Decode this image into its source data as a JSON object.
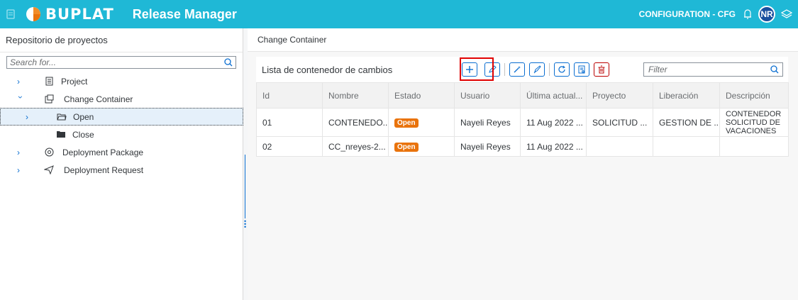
{
  "header": {
    "logo_text": "BUPLAT",
    "app_title": "Release Manager",
    "config_label": "CONFIGURATION - CFG",
    "avatar_initials": "NR",
    "icons": [
      "menu-icon",
      "logo-icon",
      "notifications-icon",
      "layers-icon"
    ]
  },
  "sidebar": {
    "title": "Repositorio de proyectos",
    "search_placeholder": "Search for...",
    "items": [
      {
        "label": "Project",
        "icon": "project-icon"
      },
      {
        "label": "Change Container",
        "icon": "change-container-icon"
      },
      {
        "label": "Open",
        "icon": "open-folder-icon"
      },
      {
        "label": "Close",
        "icon": "closed-folder-icon"
      },
      {
        "label": "Deployment Package",
        "icon": "package-icon"
      },
      {
        "label": "Deployment Request",
        "icon": "send-icon"
      }
    ]
  },
  "main": {
    "breadcrumb": "Change Container",
    "list_title": "Lista de contenedor de cambios",
    "filter_placeholder": "Filter",
    "toolbar_icons": [
      "add-icon",
      "edit-icon",
      "magic-wand-icon",
      "rocket-icon",
      "refresh-icon",
      "report-icon",
      "delete-icon"
    ],
    "columns": [
      "Id",
      "Nombre",
      "Estado",
      "Usuario",
      "Última actual...",
      "Proyecto",
      "Liberación",
      "Descripción"
    ],
    "rows": [
      {
        "id": "01",
        "nombre": "CONTENEDO...",
        "estado": "Open",
        "usuario": "Nayeli Reyes",
        "ultima": "11 Aug 2022 ...",
        "proyecto": "SOLICITUD ...",
        "liberacion": "GESTION DE ...",
        "descripcion": "CONTENEDOR SOLICITUD DE VACACIONES"
      },
      {
        "id": "02",
        "nombre": "CC_nreyes-2...",
        "estado": "Open",
        "usuario": "Nayeli Reyes",
        "ultima": "11 Aug 2022 ...",
        "proyecto": "",
        "liberacion": "",
        "descripcion": ""
      }
    ]
  },
  "colors": {
    "header_bg": "#1fb8d6",
    "accent": "#0a6ed1",
    "status_open": "#e9730c",
    "delete": "#bb0000",
    "highlight": "#e00000"
  }
}
